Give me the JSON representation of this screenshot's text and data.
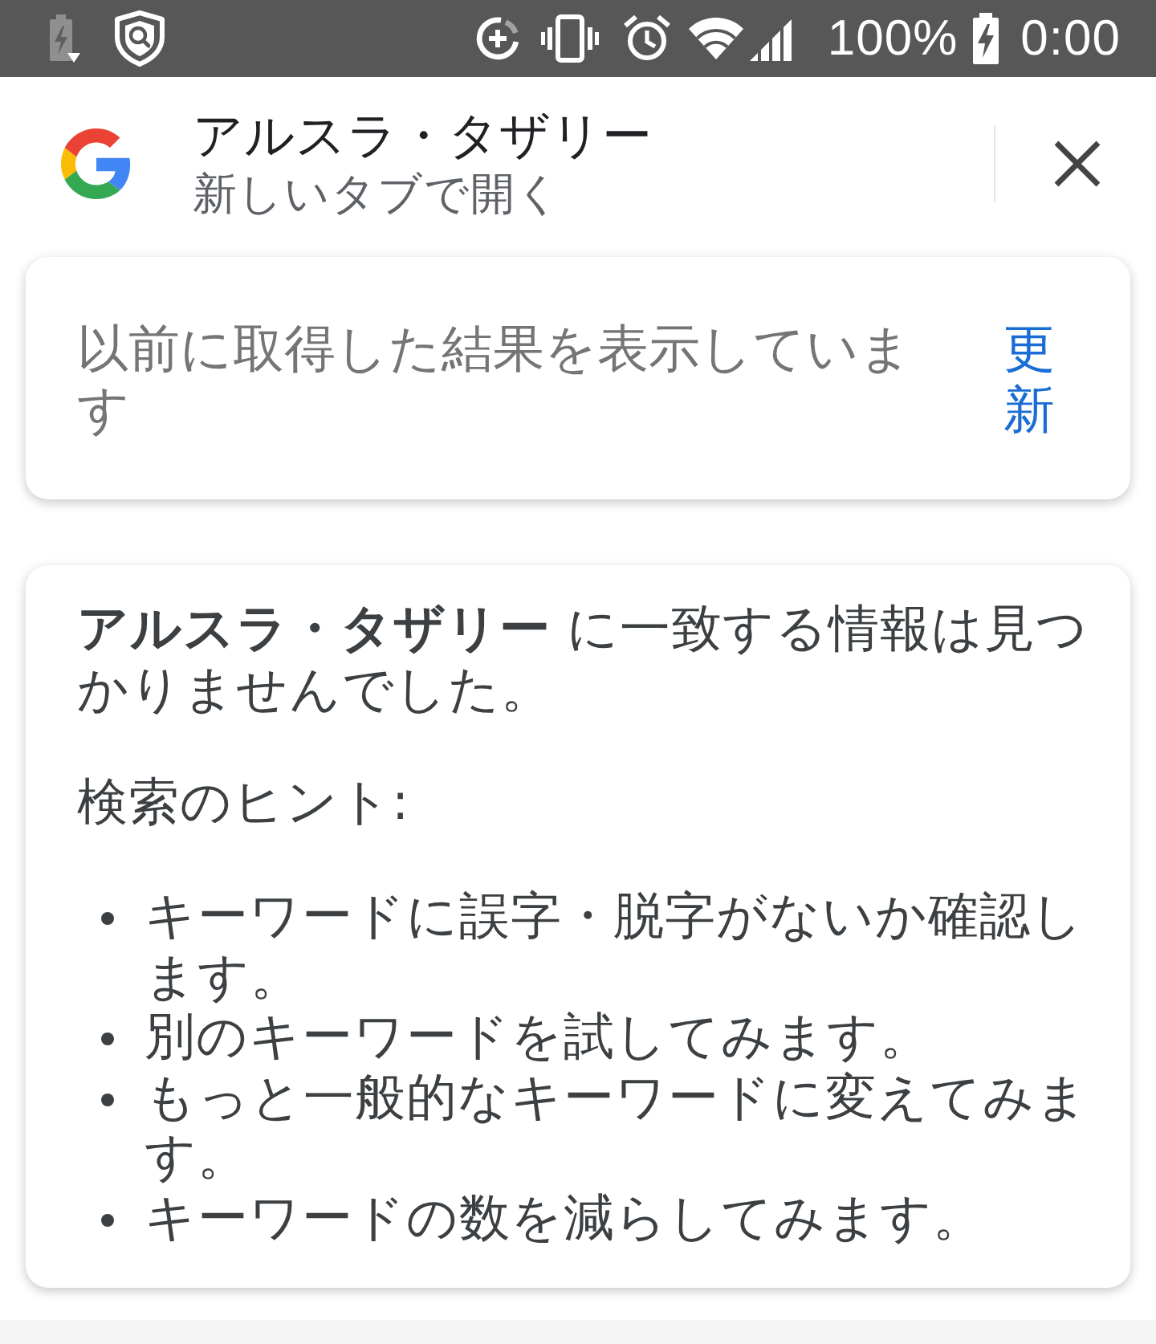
{
  "status_bar": {
    "battery_percent": "100%",
    "time": "0:00"
  },
  "header": {
    "title": "アルスラ・タザリー",
    "subtitle": "新しいタブで開く"
  },
  "notice": {
    "message": "以前に取得した結果を表示しています",
    "link": "更新"
  },
  "result": {
    "message": "**アルスラ・タザリー** に一致する情報は見つかりませんでした。",
    "tips_heading": "検索のヒント:",
    "tips": [
      "キーワードに誤字・脱字がないか確認します。",
      "別のキーワードを試してみます。",
      "もっと一般的なキーワードに変えてみます。",
      "キーワードの数を減らしてみます。"
    ]
  }
}
